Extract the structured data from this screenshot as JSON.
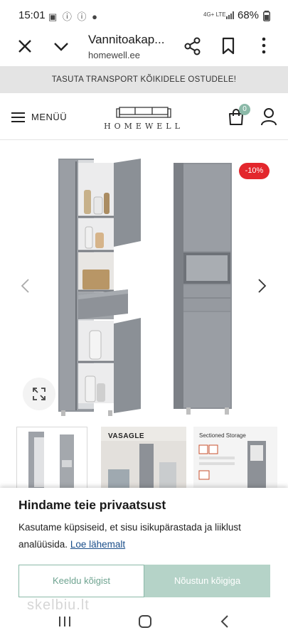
{
  "status_bar": {
    "time": "15:01",
    "left_icons": "▣ ⓘ ⓘ ●",
    "network": "4G+ LTE",
    "battery": "68%"
  },
  "browser": {
    "title": "Vannitoakap...",
    "domain": "homewell.ee"
  },
  "promo": {
    "text": "TASUTA TRANSPORT KÕIKIDELE OSTUDELE!"
  },
  "header": {
    "menu_label": "MENÜÜ",
    "logo_text": "HOMEWELL",
    "cart_count": "0",
    "accent_color": "#8bb9a8"
  },
  "product": {
    "discount": "-10%",
    "cabinet_color": "#8c9097"
  },
  "thumbnails": {
    "brand": "VASAGLE",
    "feature_title": "Sectioned Storage"
  },
  "privacy": {
    "title": "Hindame teie privaatsust",
    "text": "Kasutame küpsiseid, et sisu isikupärastada ja liiklust analüüsida.",
    "link": "Loe lähemalt",
    "decline": "Keeldu kõigist",
    "accept": "Nõustun kõigiga"
  },
  "watermark": "skelbiu.lt"
}
